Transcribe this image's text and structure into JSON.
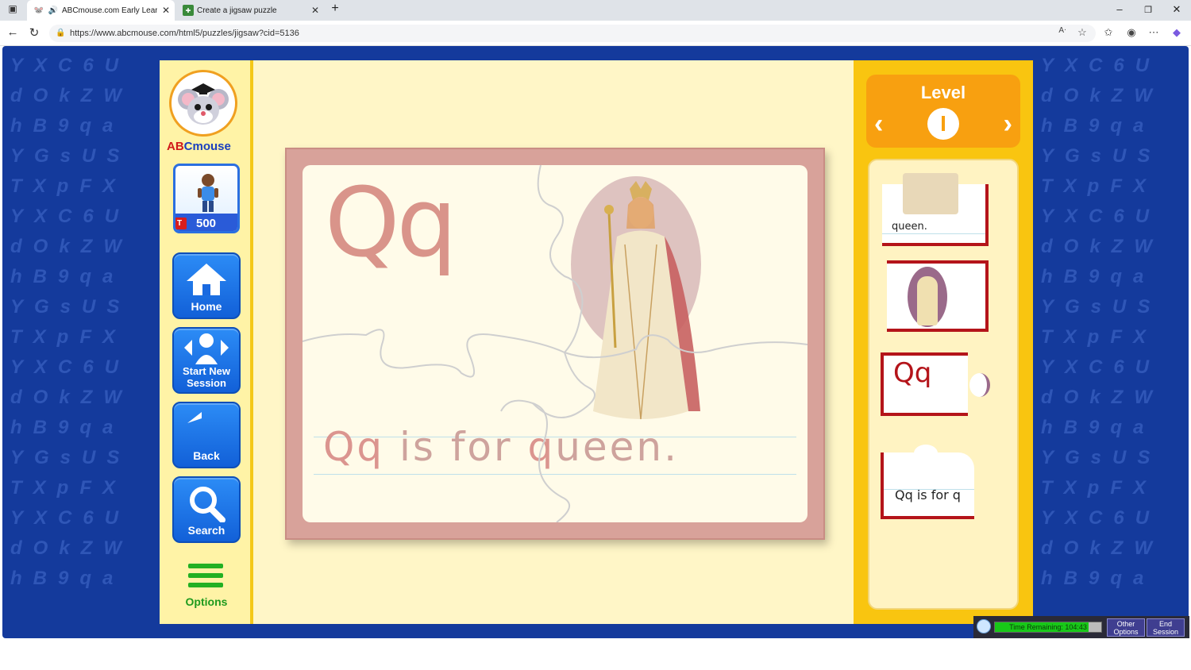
{
  "browser": {
    "tabs": [
      {
        "label": "ABCmouse.com Early Learnir",
        "active": true
      },
      {
        "label": "Create a jigsaw puzzle",
        "active": false
      }
    ],
    "url": "https://www.abcmouse.com/html5/puzzles/jigsaw?cid=5136"
  },
  "nav": {
    "logo_text_a": "AB",
    "logo_text_b": "Cmouse",
    "ticket_label": "T",
    "ticket_count": "500",
    "home_label": "Home",
    "start_new_label": "Start New Session",
    "back_label": "Back",
    "search_label": "Search",
    "options_label": "Options"
  },
  "puzzle": {
    "big_letters": "Qq",
    "sentence_letters": "Qq",
    "sentence_mid": " is for ",
    "sentence_word_first": "q",
    "sentence_word_rest": "ueen."
  },
  "level": {
    "title": "Level",
    "number": "I",
    "prev_arrow": "‹",
    "next_arrow": "›"
  },
  "pieces": {
    "p1_text": "queen.",
    "p3_text": "Qq",
    "p4_text": "Qq is for q"
  },
  "timebar": {
    "label": "Time Remaining: 104:43",
    "other_options": "Other Options",
    "end_session": "End Session"
  },
  "colors": {
    "page_bg": "#143a9c",
    "button_blue": "#1a72e8",
    "panel_yellow": "#f9c510",
    "level_orange": "#f8a010",
    "piece_border": "#b4141a"
  }
}
